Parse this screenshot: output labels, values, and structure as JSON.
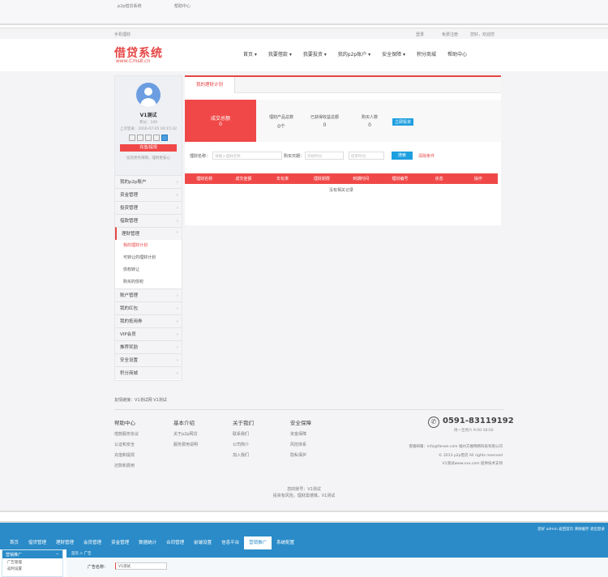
{
  "strip": {
    "links": [
      "p2p借贷系统",
      "帮助中心"
    ]
  },
  "topbar": {
    "left": "手机理财",
    "right": [
      "登录",
      "免费注册",
      "您好，欢迎您"
    ]
  },
  "logo": {
    "title": "借贷系统",
    "sub": "www.Cms8.cn"
  },
  "nav": [
    "首页 ▾",
    "我要借款 ▾",
    "我要投资 ▾",
    "我的p2p账户 ▾",
    "安全保障 ▾",
    "积分商城",
    "帮助中心"
  ],
  "sidebar": {
    "username": "V1测试",
    "points": "积分：100",
    "last_login": "上次登录：2016-07-05 00:15:42",
    "button": "充值/提现",
    "note": "投资更有保障，理财更安心",
    "menu": [
      "我的p2p账户",
      "资金管理",
      "投资管理",
      "借款管理",
      "理财管理"
    ],
    "submenu": [
      "我的理财计划",
      "可转让的理财计划",
      "债权转让",
      "购买的债权"
    ],
    "menu2": [
      "账户管理",
      "我的红包",
      "我的抵用券",
      "VIP会员",
      "推荐奖励",
      "安全设置",
      "积分商城"
    ]
  },
  "main": {
    "tab": "我的理财计划",
    "total_label": "成交总额",
    "total": "0",
    "stats": [
      {
        "label": "理财产品总数",
        "value": "0个"
      },
      {
        "label": "已获得收益总额",
        "value": "0"
      },
      {
        "label": "购买人数",
        "value": "0"
      }
    ],
    "invest_btn": "立即投资",
    "filter": {
      "name_label": "理财名称：",
      "name_ph": "请输入理财名称",
      "date_label": "购买日期：",
      "start": "开始时间",
      "end": "结束时间",
      "search": "搜索",
      "clear": "清除条件"
    },
    "headers": [
      "理财名称",
      "成交金额",
      "年化率",
      "理财期限",
      "到期时间",
      "理财编号",
      "状态",
      "操作"
    ],
    "empty": "没有相关记录"
  },
  "footer": {
    "links": "友情链接：V1测试网   V1测试",
    "cols": [
      {
        "title": "帮助中心",
        "items": [
          "借款服务协议",
          "认证和安全",
          "充值和提现",
          "还款和费用"
        ]
      },
      {
        "title": "基本介绍",
        "items": [
          "关于p2p网贷",
          "服务费用说明"
        ]
      },
      {
        "title": "关于我们",
        "items": [
          "联系我们",
          "公司简介",
          "加入我们"
        ]
      },
      {
        "title": "安全保障",
        "items": [
          "资金保障",
          "风控体系",
          "隐私保护"
        ]
      }
    ],
    "phone": "0591-83119192",
    "hours": "周一至周六 9:00-18:00",
    "email": "客服邮箱：info@fanwe.com  福州方维网络科技有限公司",
    "copyright": "© 2013 p2p借贷 All rights reserved",
    "support": "V1测试www.xxx.com 提供技术支持",
    "bottom1": "您的账号：V1测试",
    "bottom2": "投资有风险，理财需谨慎，V1测试"
  },
  "admin": {
    "right": "您好 admin   返回首页 清除缓存 退出登录",
    "tabs": [
      "首页",
      "借贷管理",
      "理财管理",
      "会员管理",
      "资金管理",
      "数据统计",
      "合同管理",
      "前端设置",
      "信息平台",
      "营销推广",
      "系统配置"
    ],
    "left_title": "营销推广",
    "left_items": [
      "广告管理",
      "返利设置"
    ],
    "breadcrumb": "首页 > 广告",
    "field_label": "广告名称：",
    "field_value": "V1测试"
  }
}
